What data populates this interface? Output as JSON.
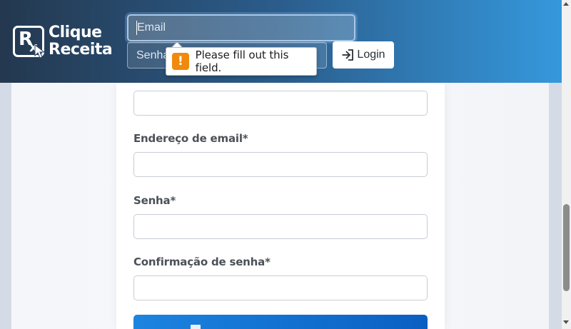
{
  "header": {
    "brand_line1": "Clique",
    "brand_line2": "Receita",
    "logo_mark": "R",
    "logo_mark_sub": "x",
    "email_placeholder": "Email",
    "senha_placeholder": "Senha",
    "login_label": "Login",
    "login_icon": "sign-in-icon"
  },
  "validation_tooltip": {
    "message": "Please fill out this field.",
    "icon": "warning-icon",
    "icon_glyph": "!"
  },
  "form": {
    "fields": [
      {
        "label": "",
        "value": ""
      },
      {
        "label": "Endereço de email*",
        "value": ""
      },
      {
        "label": "Senha*",
        "value": ""
      },
      {
        "label": "Confirmação de senha*",
        "value": ""
      }
    ],
    "submit_label": ""
  },
  "colors": {
    "navbar_start": "#24384f",
    "navbar_end": "#3598dc",
    "submit": "#1c84e0",
    "warning": "#f08a0c"
  }
}
